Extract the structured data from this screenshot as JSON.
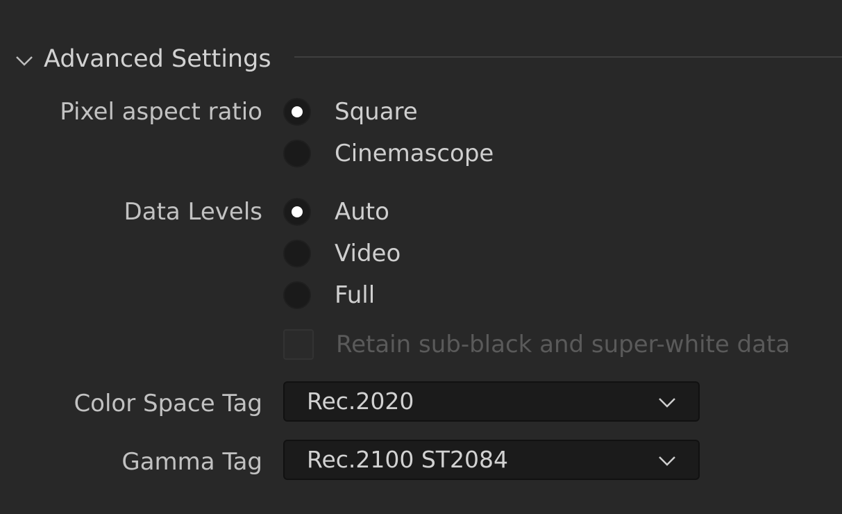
{
  "section": {
    "title": "Advanced Settings",
    "expanded": true,
    "icon": "chevron-down-icon"
  },
  "pixel_aspect": {
    "label": "Pixel aspect ratio",
    "options": [
      {
        "label": "Square",
        "checked": true
      },
      {
        "label": "Cinemascope",
        "checked": false
      }
    ]
  },
  "data_levels": {
    "label": "Data Levels",
    "options": [
      {
        "label": "Auto",
        "checked": true
      },
      {
        "label": "Video",
        "checked": false
      },
      {
        "label": "Full",
        "checked": false
      }
    ],
    "retain_checkbox": {
      "label": "Retain sub-black and super-white data",
      "checked": false,
      "enabled": false
    }
  },
  "color_space_tag": {
    "label": "Color Space Tag",
    "value": "Rec.2020"
  },
  "gamma_tag": {
    "label": "Gamma Tag",
    "value": "Rec.2100 ST2084"
  },
  "colors": {
    "background": "#282828",
    "dropdown_bg": "#1b1b1b",
    "radio_fill": "#1a1a1a",
    "radio_dot": "#ffffff"
  }
}
